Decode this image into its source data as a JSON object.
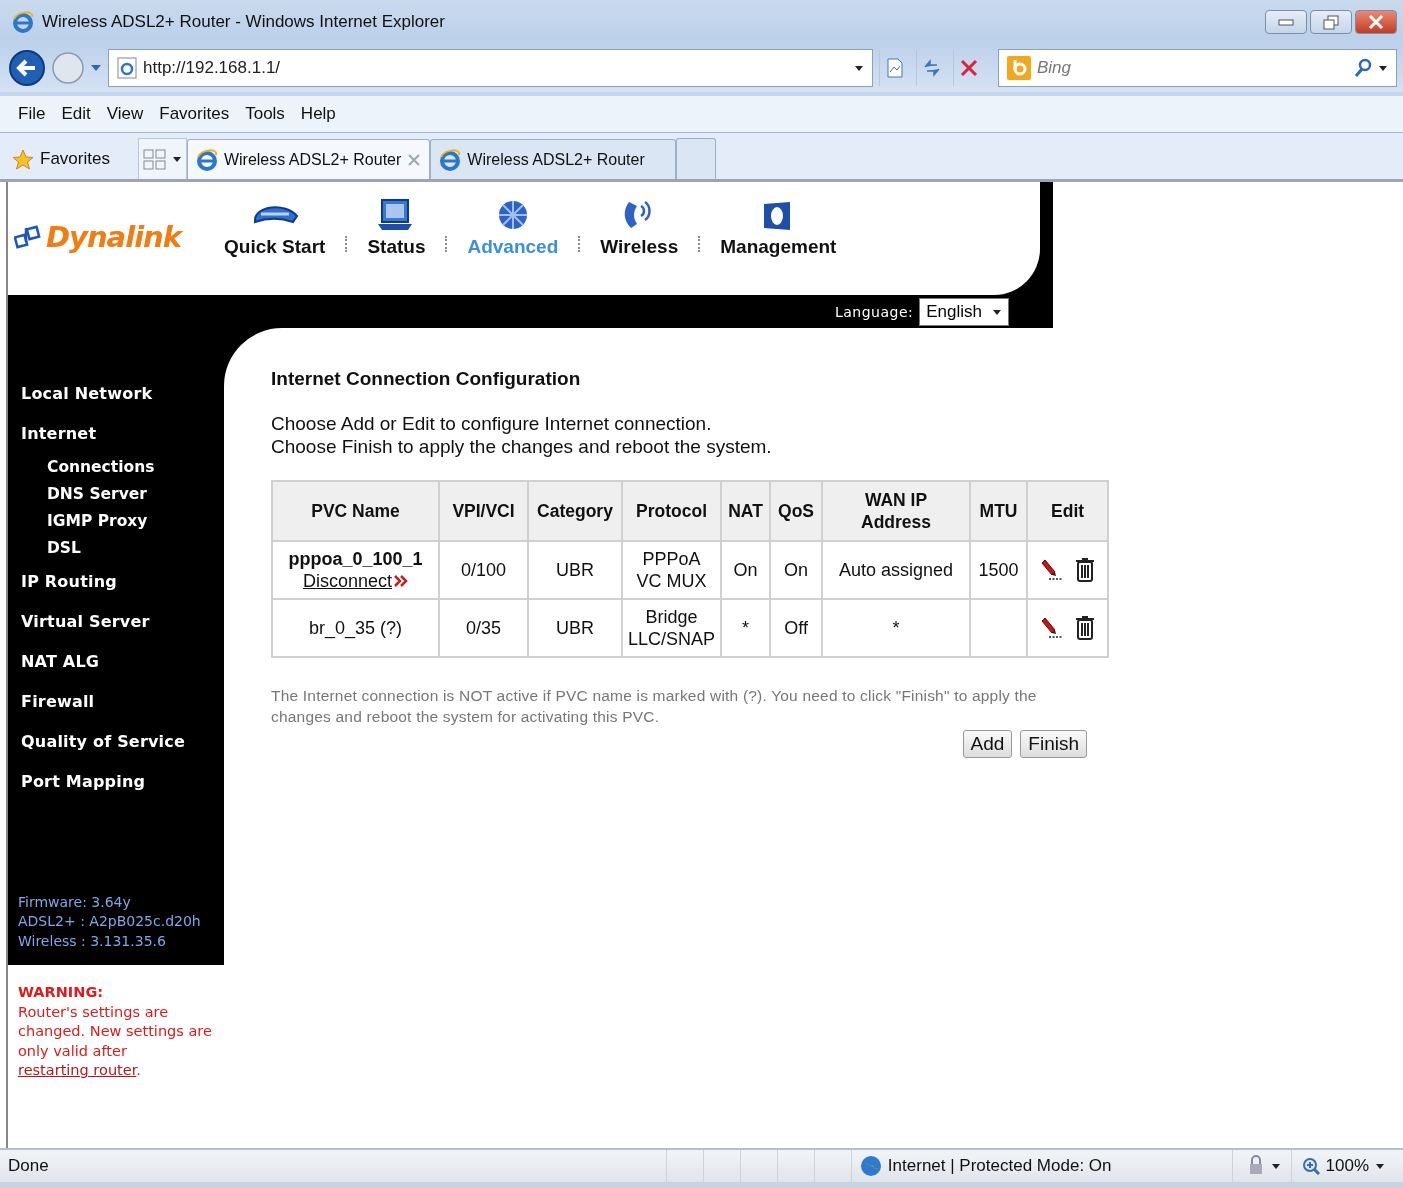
{
  "browser": {
    "title": "Wireless ADSL2+ Router - Windows Internet Explorer",
    "address": "http://192.168.1.1/",
    "search_placeholder": "Bing",
    "menu": [
      "File",
      "Edit",
      "View",
      "Favorites",
      "Tools",
      "Help"
    ],
    "favorites_label": "Favorites",
    "tabs": [
      {
        "label": "Wireless ADSL2+ Router",
        "selected": true
      },
      {
        "label": "Wireless ADSL2+ Router",
        "selected": false
      }
    ]
  },
  "router": {
    "logo": "Dynalink",
    "nav": [
      {
        "label": "Quick Start",
        "selected": false
      },
      {
        "label": "Status",
        "selected": false
      },
      {
        "label": "Advanced",
        "selected": true
      },
      {
        "label": "Wireless",
        "selected": false
      },
      {
        "label": "Management",
        "selected": false
      }
    ],
    "language_label": "Language:",
    "language": "English",
    "sidebar": [
      {
        "label": "Local Network"
      },
      {
        "label": "Internet",
        "children": [
          {
            "label": "Connections"
          },
          {
            "label": "DNS Server"
          },
          {
            "label": "IGMP Proxy"
          },
          {
            "label": "DSL"
          }
        ]
      },
      {
        "label": "IP Routing"
      },
      {
        "label": "Virtual Server"
      },
      {
        "label": "NAT ALG"
      },
      {
        "label": "Firewall"
      },
      {
        "label": "Quality of Service"
      },
      {
        "label": "Port Mapping"
      }
    ],
    "versions": [
      {
        "label": "Firmware:",
        "value": "3.64y"
      },
      {
        "label": "ADSL2+ :",
        "value": "A2pB025c.d20h"
      },
      {
        "label": "Wireless :",
        "value": "3.131.35.6"
      }
    ],
    "warning": {
      "title": "WARNING:",
      "text": "Router's settings are changed. New settings are only valid after",
      "link": "restarting router",
      "end": "."
    },
    "heading": "Internet Connection Configuration",
    "instructions": [
      "Choose Add or Edit to configure Internet connection.",
      "Choose Finish to apply the changes and reboot the system."
    ],
    "table": {
      "columns": [
        "PVC Name",
        "VPI/VCI",
        "Category",
        "Protocol",
        "NAT",
        "QoS",
        "WAN IP\nAddress",
        "MTU",
        "Edit"
      ],
      "rows": [
        {
          "active": true,
          "action": "Disconnect",
          "cells": [
            "pppoa_0_100_1",
            "0/100",
            "UBR",
            "PPPoA\nVC MUX",
            "On",
            "On",
            "Auto assigned",
            "1500"
          ]
        },
        {
          "active": false,
          "cells": [
            "br_0_35 (?)",
            "0/35",
            "UBR",
            "Bridge\nLLC/SNAP",
            "*",
            "Off",
            "*",
            null
          ]
        }
      ]
    },
    "note": "The Internet connection is NOT active if PVC name is marked with (?). You need to click \"Finish\" to apply the changes and reboot the system for activating this PVC.",
    "buttons": [
      "Add",
      "Finish"
    ]
  },
  "status_bar": {
    "text": "Done",
    "zone": "Internet | Protected Mode: On",
    "zoom": "100%"
  }
}
